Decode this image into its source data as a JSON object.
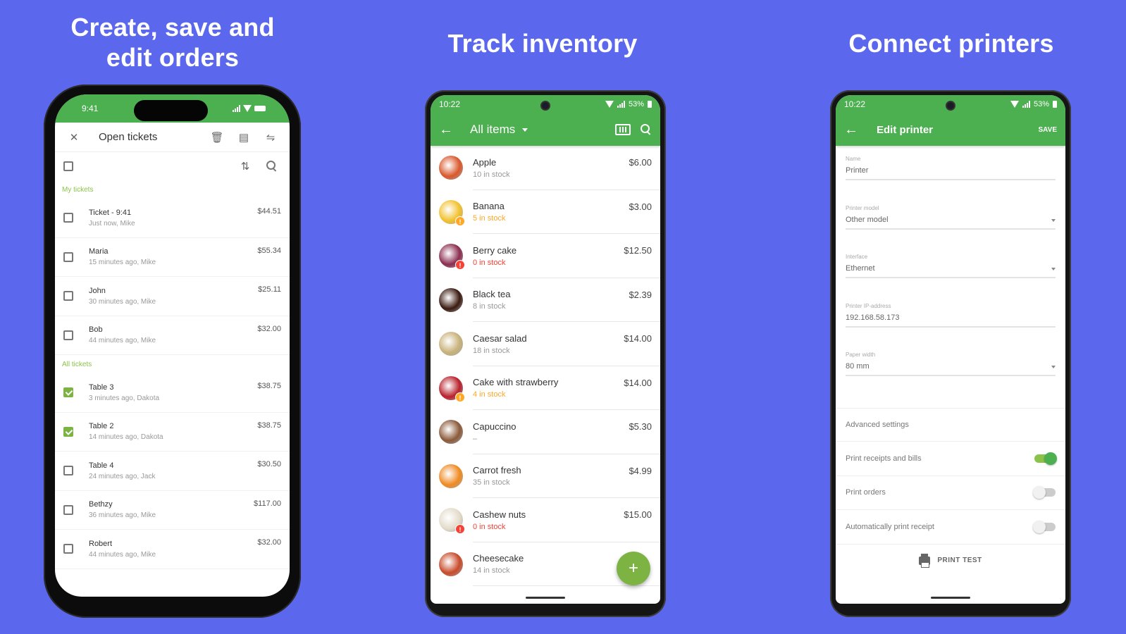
{
  "headlines": {
    "orders": "Create, save and edit orders",
    "inventory": "Track inventory",
    "printers": "Connect printers"
  },
  "colors": {
    "background": "#5b67ec",
    "brand_green": "#4caf50",
    "fab_green": "#7cb342",
    "warning_orange": "#ffa726",
    "error_red": "#f44336"
  },
  "orders_screen": {
    "status_time": "9:41",
    "title": "Open tickets",
    "icons": [
      "close-icon",
      "delete-icon",
      "save-icon",
      "assign-user-icon",
      "sort-icon",
      "search-icon"
    ],
    "sections": [
      {
        "label": "My tickets",
        "tickets": [
          {
            "name": "Ticket - 9:41",
            "meta": "Just now, Mike",
            "amount": "$44.51",
            "checked": false
          },
          {
            "name": "Maria",
            "meta": "15 minutes ago, Mike",
            "amount": "$55.34",
            "checked": false
          },
          {
            "name": "John",
            "meta": "30 minutes ago, Mike",
            "amount": "$25.11",
            "checked": false
          },
          {
            "name": "Bob",
            "meta": "44 minutes ago, Mike",
            "amount": "$32.00",
            "checked": false
          }
        ]
      },
      {
        "label": "All tickets",
        "tickets": [
          {
            "name": "Table 3",
            "meta": "3 minutes ago, Dakota",
            "amount": "$38.75",
            "checked": true
          },
          {
            "name": "Table 2",
            "meta": "14 minutes ago, Dakota",
            "amount": "$38.75",
            "checked": true
          },
          {
            "name": "Table 4",
            "meta": "24 minutes ago, Jack",
            "amount": "$30.50",
            "checked": false
          },
          {
            "name": "Bethzy",
            "meta": "36 minutes ago, Mike",
            "amount": "$117.00",
            "checked": false
          },
          {
            "name": "Robert",
            "meta": "44 minutes ago, Mike",
            "amount": "$32.00",
            "checked": false
          }
        ]
      }
    ]
  },
  "inventory_screen": {
    "status_time": "10:22",
    "battery": "53%",
    "title": "All items",
    "fab_label": "+",
    "items": [
      {
        "name": "Apple",
        "stock": "10 in stock",
        "price": "$6.00",
        "level": "normal",
        "thumb": "#d9582b"
      },
      {
        "name": "Banana",
        "stock": "5 in stock",
        "price": "$3.00",
        "level": "low",
        "thumb": "#f2c12e"
      },
      {
        "name": "Berry cake",
        "stock": "0 in stock",
        "price": "$12.50",
        "level": "out",
        "thumb": "#8b2d4f"
      },
      {
        "name": "Black tea",
        "stock": "8  in stock",
        "price": "$2.39",
        "level": "normal",
        "thumb": "#3a1a10"
      },
      {
        "name": "Caesar salad",
        "stock": "18 in stock",
        "price": "$14.00",
        "level": "normal",
        "thumb": "#c8b27a"
      },
      {
        "name": "Cake with strawberry",
        "stock": "4 in stock",
        "price": "$14.00",
        "level": "low",
        "thumb": "#b8202c"
      },
      {
        "name": "Capuccino",
        "stock": "–",
        "price": "$5.30",
        "level": "normal",
        "thumb": "#8a5a3a"
      },
      {
        "name": "Carrot fresh",
        "stock": "35 in stock",
        "price": "$4.99",
        "level": "normal",
        "thumb": "#f08a22"
      },
      {
        "name": "Cashew nuts",
        "stock": "0 in stock",
        "price": "$15.00",
        "level": "out",
        "thumb": "#e4dccb"
      },
      {
        "name": "Cheesecake",
        "stock": "14 in stock",
        "price": "",
        "level": "normal",
        "thumb": "#c84a2a"
      }
    ]
  },
  "printer_screen": {
    "status_time": "10:22",
    "battery": "53%",
    "title": "Edit printer",
    "save_label": "SAVE",
    "fields": [
      {
        "label": "Name",
        "value": "Printer",
        "dropdown": false
      },
      {
        "label": "Printer model",
        "value": "Other model",
        "dropdown": true
      },
      {
        "label": "Interface",
        "value": "Ethernet",
        "dropdown": true
      },
      {
        "label": "Printer IP-address",
        "value": "192.168.58.173",
        "dropdown": false
      },
      {
        "label": "Paper width",
        "value": "80 mm",
        "dropdown": true
      }
    ],
    "advanced_label": "Advanced settings",
    "toggles": [
      {
        "label": "Print receipts and bills",
        "on": true
      },
      {
        "label": "Print orders",
        "on": false
      },
      {
        "label": "Automatically print receipt",
        "on": false
      }
    ],
    "print_test_label": "PRINT TEST"
  }
}
